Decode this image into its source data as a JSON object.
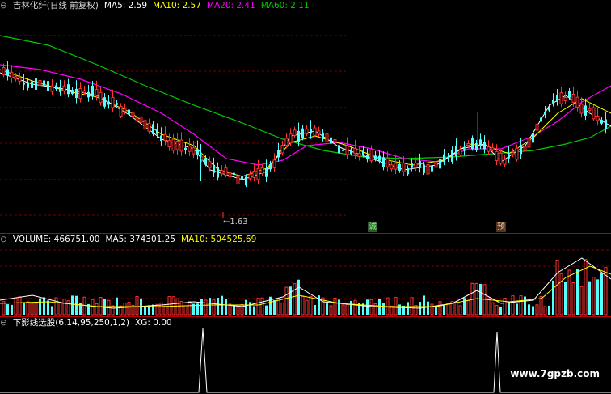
{
  "price_panel": {
    "title": "吉林化纤(日线 前复权)",
    "ma": [
      {
        "label": "MA5: 2.59",
        "color": "#ffffff"
      },
      {
        "label": "MA10: 2.57",
        "color": "#ffff00"
      },
      {
        "label": "MA20: 2.41",
        "color": "#ff00ff"
      },
      {
        "label": "MA60: 2.11",
        "color": "#00cc00"
      }
    ],
    "low_label": "←1.63",
    "mark_left": "诚",
    "mark_right": "预"
  },
  "volume_panel": {
    "items": [
      {
        "label": "VOLUME: 466751.00",
        "color": "#ffffff"
      },
      {
        "label": "MA5: 374301.25",
        "color": "#ffffff"
      },
      {
        "label": "MA10: 504525.69",
        "color": "#ffff00"
      }
    ]
  },
  "indicator_panel": {
    "items": [
      {
        "label": "下影线选股(6,14,95,250,1,2)",
        "color": "#ffffff"
      },
      {
        "label": "XG: 0.00",
        "color": "#ffffff"
      }
    ]
  },
  "watermark": "www.7gpzb.com",
  "colors": {
    "up": "#ff3232",
    "down": "#54ffff",
    "grid": "#7a0000",
    "separator": "#c00000"
  }
}
